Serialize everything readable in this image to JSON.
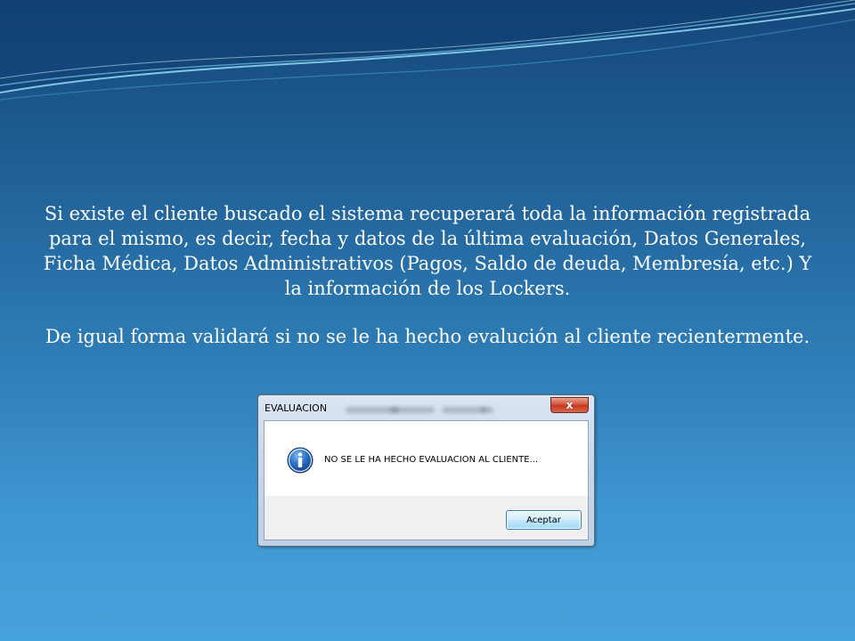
{
  "slide": {
    "paragraph_1": "Si existe el cliente buscado el sistema recuperará toda la información registrada para el mismo, es decir, fecha y datos de la última evaluación, Datos Generales, Ficha Médica, Datos Administrativos (Pagos, Saldo de deuda, Membresía, etc.) Y la información de los Lockers.",
    "paragraph_2": "De igual forma validará si no se le ha hecho evalución al cliente recientermente."
  },
  "dialog": {
    "title": "EVALUACION",
    "close_label": "x",
    "message": "NO SE LE HA HECHO EVALUACION AL CLIENTE...",
    "icon": "info-icon",
    "ok_label": "Aceptar"
  },
  "colors": {
    "background_top": "#15477a",
    "background_bottom": "#46a2da",
    "close_button": "#c13a21",
    "info_icon": "#1f5fb4"
  }
}
